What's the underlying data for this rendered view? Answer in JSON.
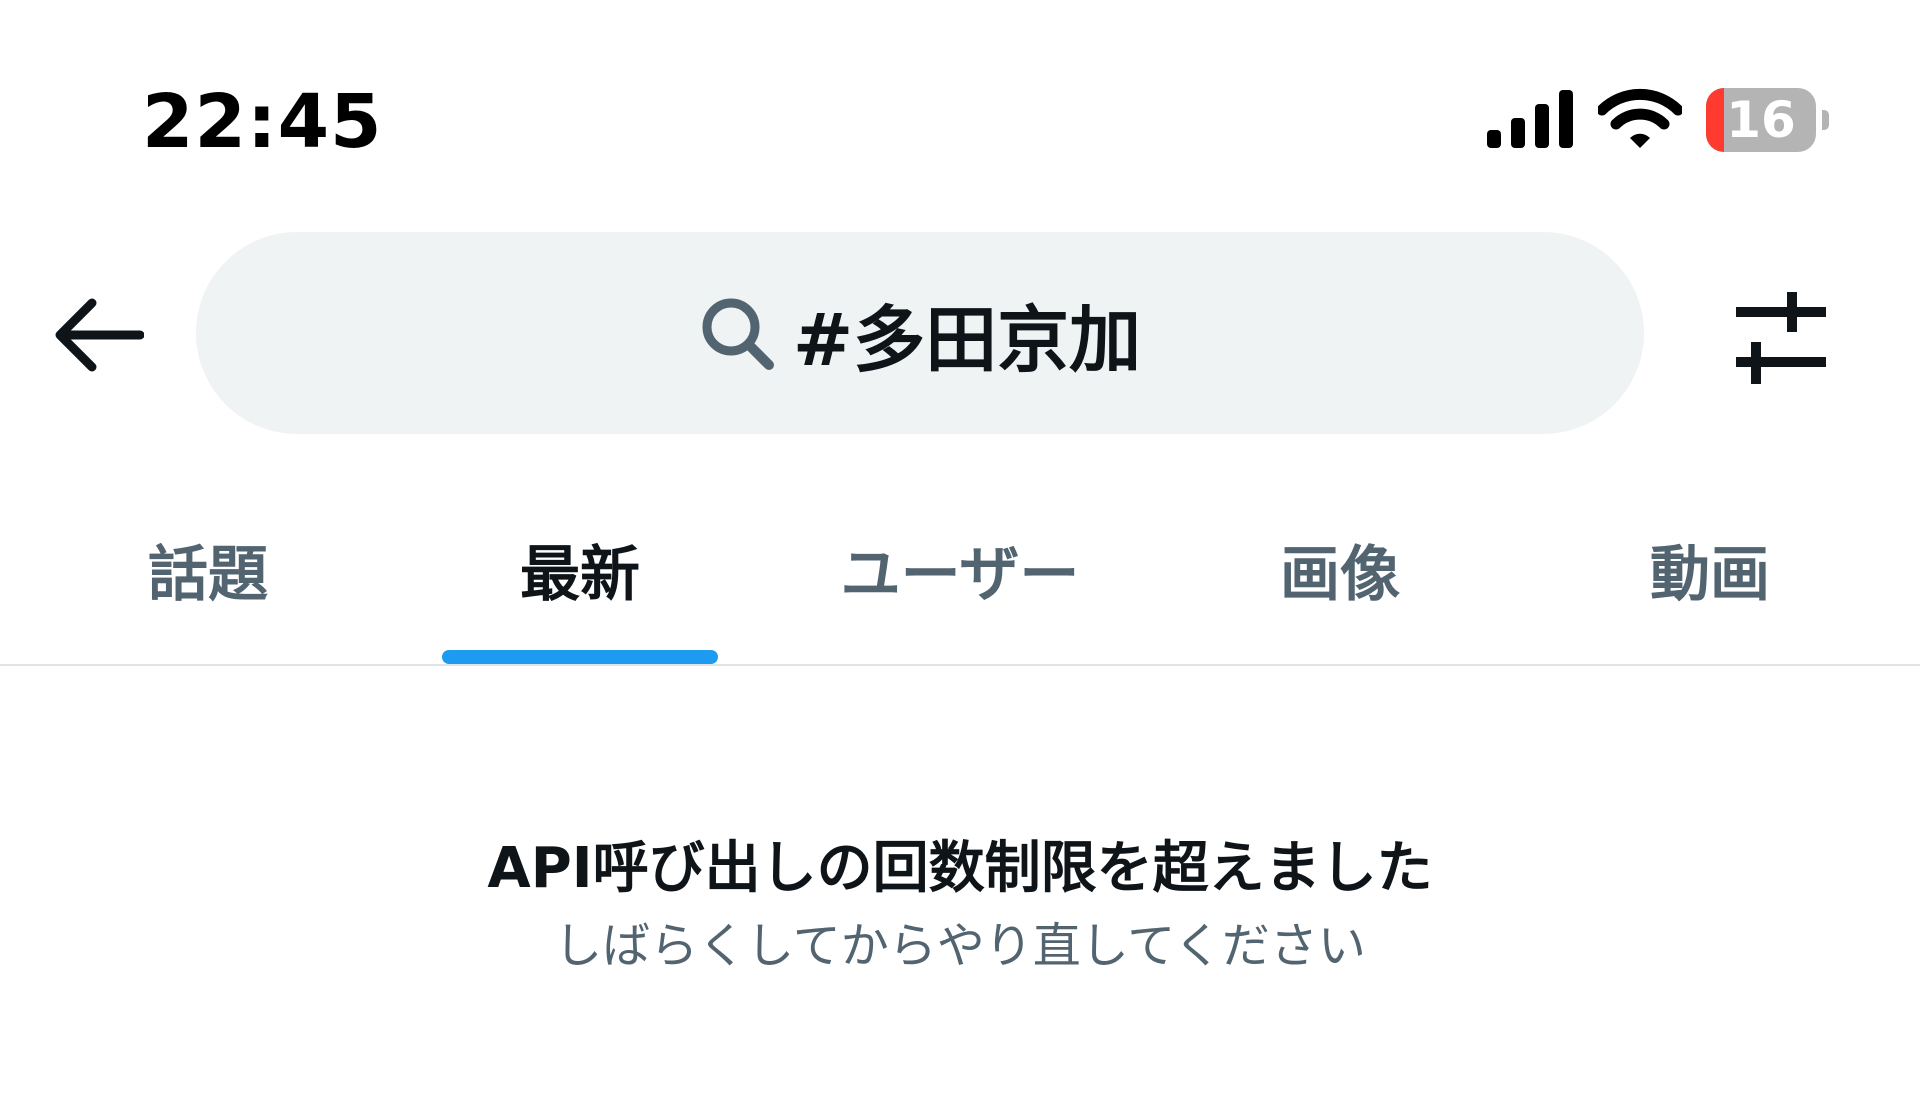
{
  "status_bar": {
    "time": "22:45",
    "battery_level": "16",
    "battery_fraction": 0.16,
    "signal_icon": "cellular-signal-icon",
    "wifi_icon": "wifi-icon"
  },
  "header": {
    "back_icon": "arrow-left-icon",
    "search_icon": "search-icon",
    "search_query": "#多田京加",
    "filter_icon": "sliders-icon"
  },
  "tabs": [
    {
      "label": "話題",
      "active": false
    },
    {
      "label": "最新",
      "active": true
    },
    {
      "label": "ユーザー",
      "active": false
    },
    {
      "label": "画像",
      "active": false
    },
    {
      "label": "動画",
      "active": false
    }
  ],
  "message": {
    "title": "API呼び出しの回数制限を超えました",
    "subtitle": "しばらくしてからやり直してください"
  },
  "colors": {
    "accent": "#1d9bf0",
    "text_primary": "#0f1419",
    "text_secondary": "#536471",
    "search_background": "#eff3f4",
    "battery_low": "#ff3b30"
  }
}
